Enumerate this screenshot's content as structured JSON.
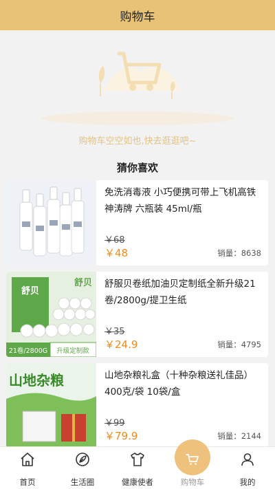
{
  "header": {
    "title": "购物车"
  },
  "empty": {
    "message": "购物车空空如也,快去逛逛吧~"
  },
  "recommend": {
    "title": "猜你喜欢"
  },
  "currency": "￥",
  "products": [
    {
      "name": "免洗消毒液 小巧便携可带上飞机高铁神涛牌 六瓶装 45ml/瓶",
      "original_price": "68",
      "price": "48",
      "sales_label": "销量：",
      "sales": "8638",
      "image_text": []
    },
    {
      "name": "舒服贝卷纸加油贝定制纸全新升级21卷/2800g/提卫生纸",
      "original_price": "35",
      "price": "24.9",
      "sales_label": "销量：",
      "sales": "4795",
      "image_text": [
        "舒贝",
        "21卷/2800G",
        "升级定制款"
      ]
    },
    {
      "name": "山地杂粮礼盒（十种杂粮送礼佳品）400克/袋 10袋/盒",
      "original_price": "99",
      "price": "79.9",
      "sales_label": "销量：",
      "sales": "2144",
      "image_text": [
        "山地杂粮"
      ]
    }
  ],
  "tabbar": {
    "items": [
      {
        "label": "首页",
        "icon": "home-icon"
      },
      {
        "label": "生活圈",
        "icon": "life-circle-icon"
      },
      {
        "label": "健康使者",
        "icon": "shirt-icon"
      },
      {
        "label": "购物车",
        "icon": "cart-icon",
        "active": true
      },
      {
        "label": "我的",
        "icon": "user-icon"
      }
    ]
  },
  "colors": {
    "header_bg": "#e8c377",
    "price": "#f08a1c",
    "accent": "#eec27c",
    "empty_text": "#e3c282"
  }
}
